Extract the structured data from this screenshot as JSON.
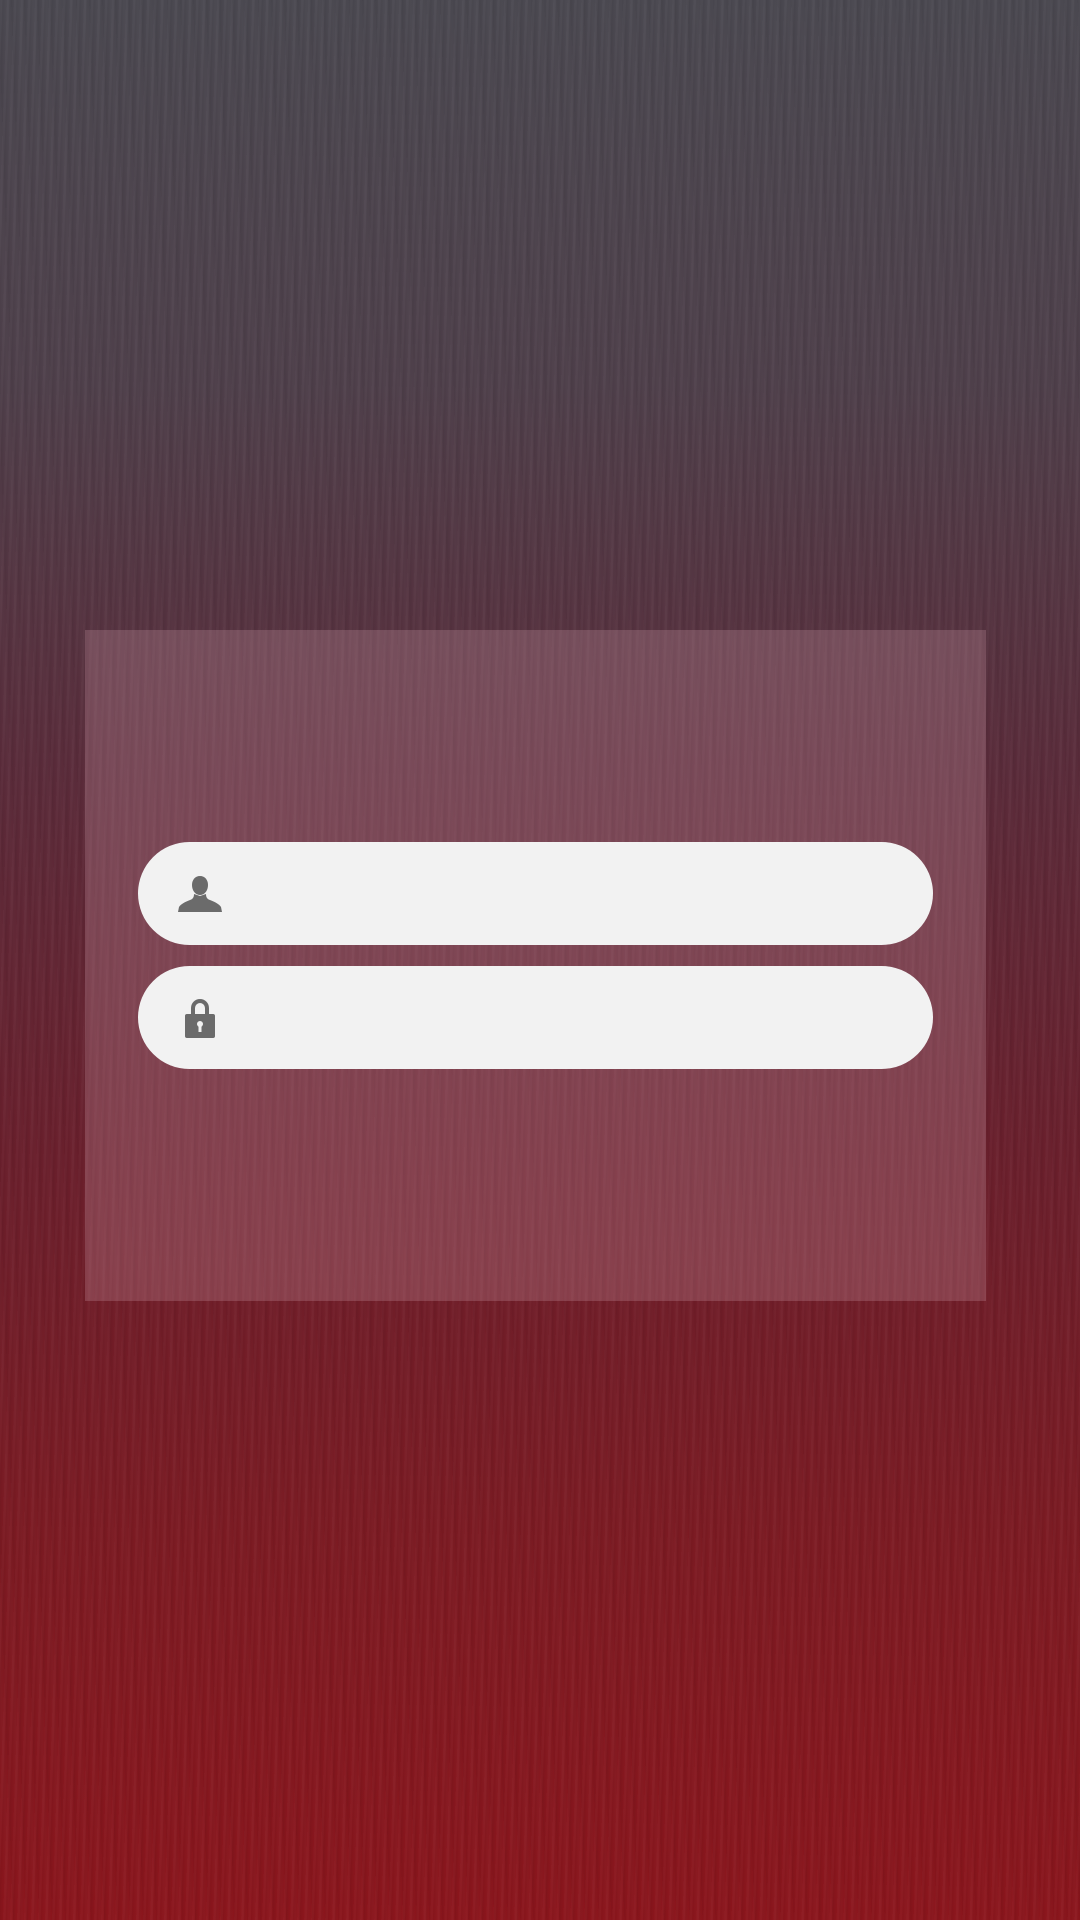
{
  "login": {
    "username": {
      "icon": "user-icon",
      "value": "",
      "placeholder": ""
    },
    "password": {
      "icon": "lock-icon",
      "value": "",
      "placeholder": ""
    }
  },
  "colors": {
    "background_top": "#4a4850",
    "background_bottom": "#8b151c",
    "field_background": "#f2f2f2",
    "icon": "#6b6b6b"
  }
}
